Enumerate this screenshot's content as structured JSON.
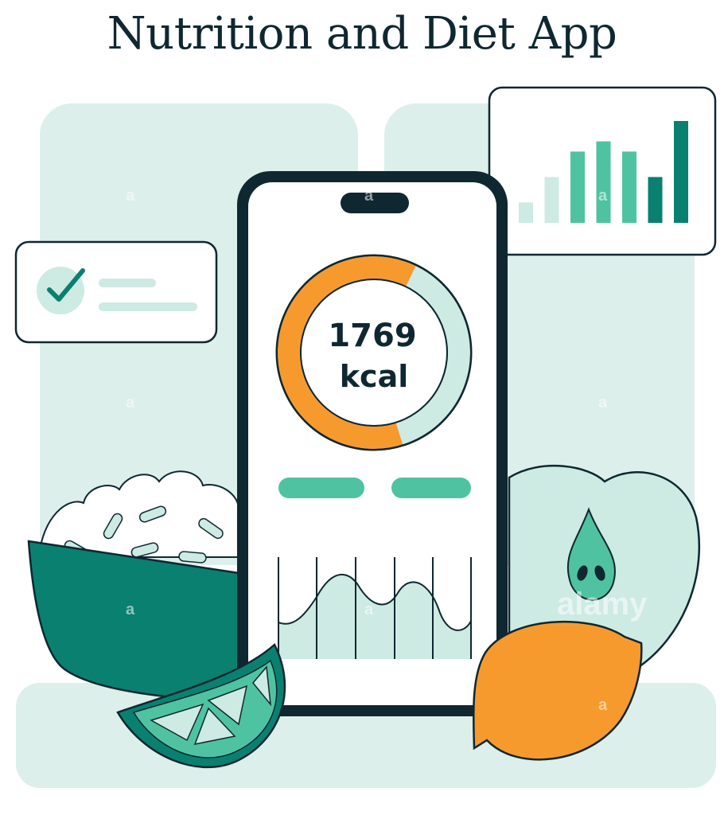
{
  "title": "Nutrition and Diet App",
  "calories": {
    "value": "1769",
    "unit": "kcal",
    "progress": 0.62
  },
  "colors": {
    "dark": "#0f2730",
    "teal": "#4fc3a1",
    "dark_teal": "#0a8070",
    "mint": "#cdeae3",
    "light_mint": "#dcefeb",
    "orange": "#f79a2e"
  },
  "stats_card": {
    "bars": [
      0.2,
      0.45,
      0.7,
      0.8,
      0.7,
      0.45,
      1.0
    ]
  },
  "icons": [
    "checkmark-icon",
    "bar-chart-icon",
    "donut-progress-icon",
    "area-chart-icon"
  ],
  "watermark": "alamy"
}
